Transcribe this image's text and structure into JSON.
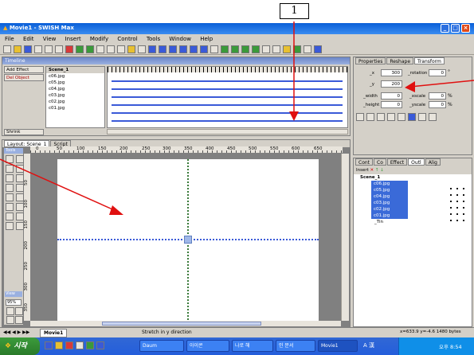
{
  "annotation": {
    "label": "1"
  },
  "app": {
    "title": "Movie1 - SWISH Max"
  },
  "menu": [
    "File",
    "Edit",
    "View",
    "Insert",
    "Modify",
    "Control",
    "Tools",
    "Window",
    "Help"
  ],
  "timeline": {
    "title": "Timeline",
    "add_effect": "Add Effect",
    "del_object": "Del Object",
    "shrink": "Shrink",
    "scene": "Scene_1",
    "layers": [
      "c06.jpg",
      "c05.jpg",
      "c04.jpg",
      "c03.jpg",
      "c02.jpg",
      "c01.jpg"
    ]
  },
  "properties": {
    "tabs": [
      "Properties",
      "Reshape",
      "Transform"
    ],
    "x_label": "_x",
    "x_value": "300",
    "y_label": "_y",
    "y_value": "200",
    "width_label": "_width",
    "width_value": "0",
    "height_label": "_height",
    "height_value": "0",
    "rotation_label": "_rotation",
    "rotation_value": "0",
    "xscale_label": "_xscale",
    "xscale_value": "0",
    "yscale_label": "_yscale",
    "yscale_value": "0",
    "deg": "°",
    "pct": "%"
  },
  "layout": {
    "tabs": [
      "Layout: Scene_1",
      "Script"
    ],
    "ruler": [
      "0",
      "50",
      "100",
      "150",
      "200",
      "250",
      "300",
      "350",
      "400",
      "450",
      "500",
      "550",
      "600",
      "650"
    ],
    "side_ruler": [
      "50",
      "100",
      "150",
      "200",
      "250",
      "300",
      "350"
    ],
    "tools_label": "Tools",
    "view_label": "View",
    "zoom": "95%"
  },
  "outline": {
    "tabs": [
      "Cont",
      "Co",
      "Effect",
      "Outl",
      "Alig"
    ],
    "insert": "Insert",
    "scene": "Scene_1",
    "items": [
      "c06.jpg",
      "c05.jpg",
      "c04.jpg",
      "c03.jpg",
      "c02.jpg",
      "c01.jpg"
    ],
    "tin": "_Tin"
  },
  "status": {
    "movie_tab": "Movie1",
    "message": "Stretch in y direction",
    "coords": "x=633.9 y=-4.6 1480 bytes"
  },
  "taskbar": {
    "start": "시작",
    "items": [
      "Daum",
      "아이콘",
      "나로 해",
      "인 문서",
      "Movie1"
    ],
    "ime": "A 漢",
    "clock": "오후 8:54"
  }
}
